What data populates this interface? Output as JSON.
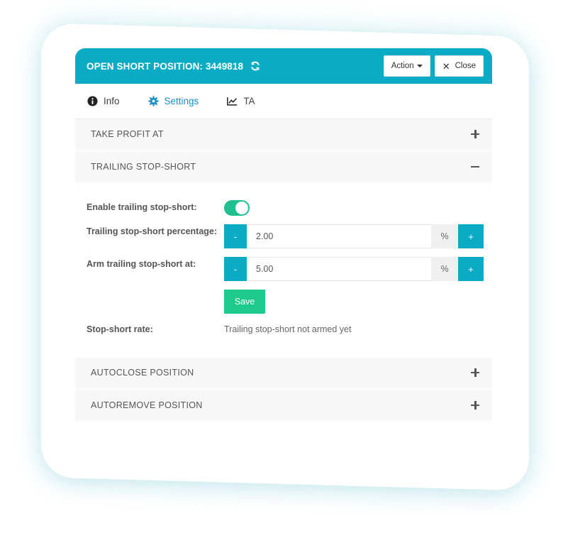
{
  "header": {
    "title": "OPEN SHORT POSITION: 3449818",
    "action_label": "Action",
    "close_label": "Close",
    "accent_color": "#0aacc5"
  },
  "tabs": [
    {
      "label": "Info",
      "icon": "info-circle-icon",
      "active": false
    },
    {
      "label": "Settings",
      "icon": "gear-icon",
      "active": true
    },
    {
      "label": "TA",
      "icon": "line-chart-icon",
      "active": false
    }
  ],
  "sections": {
    "take_profit": {
      "label": "TAKE PROFIT AT",
      "expanded": false
    },
    "trailing": {
      "label": "TRAILING STOP-SHORT",
      "expanded": true,
      "enable_label": "Enable trailing stop-short:",
      "enabled": true,
      "percentage_label": "Trailing stop-short percentage:",
      "percentage_value": "2.00",
      "arm_label": "Arm trailing stop-short at:",
      "arm_value": "5.00",
      "unit": "%",
      "minus_label": "-",
      "plus_label": "+",
      "save_label": "Save",
      "rate_label": "Stop-short rate:",
      "rate_value": "Trailing stop-short not armed yet"
    },
    "autoclose": {
      "label": "AUTOCLOSE POSITION",
      "expanded": false
    },
    "autoremove": {
      "label": "AUTOREMOVE POSITION",
      "expanded": false
    }
  },
  "colors": {
    "toggle_on": "#1fbf8f",
    "save": "#1dc98d",
    "tab_active": "#1a8fc7"
  }
}
